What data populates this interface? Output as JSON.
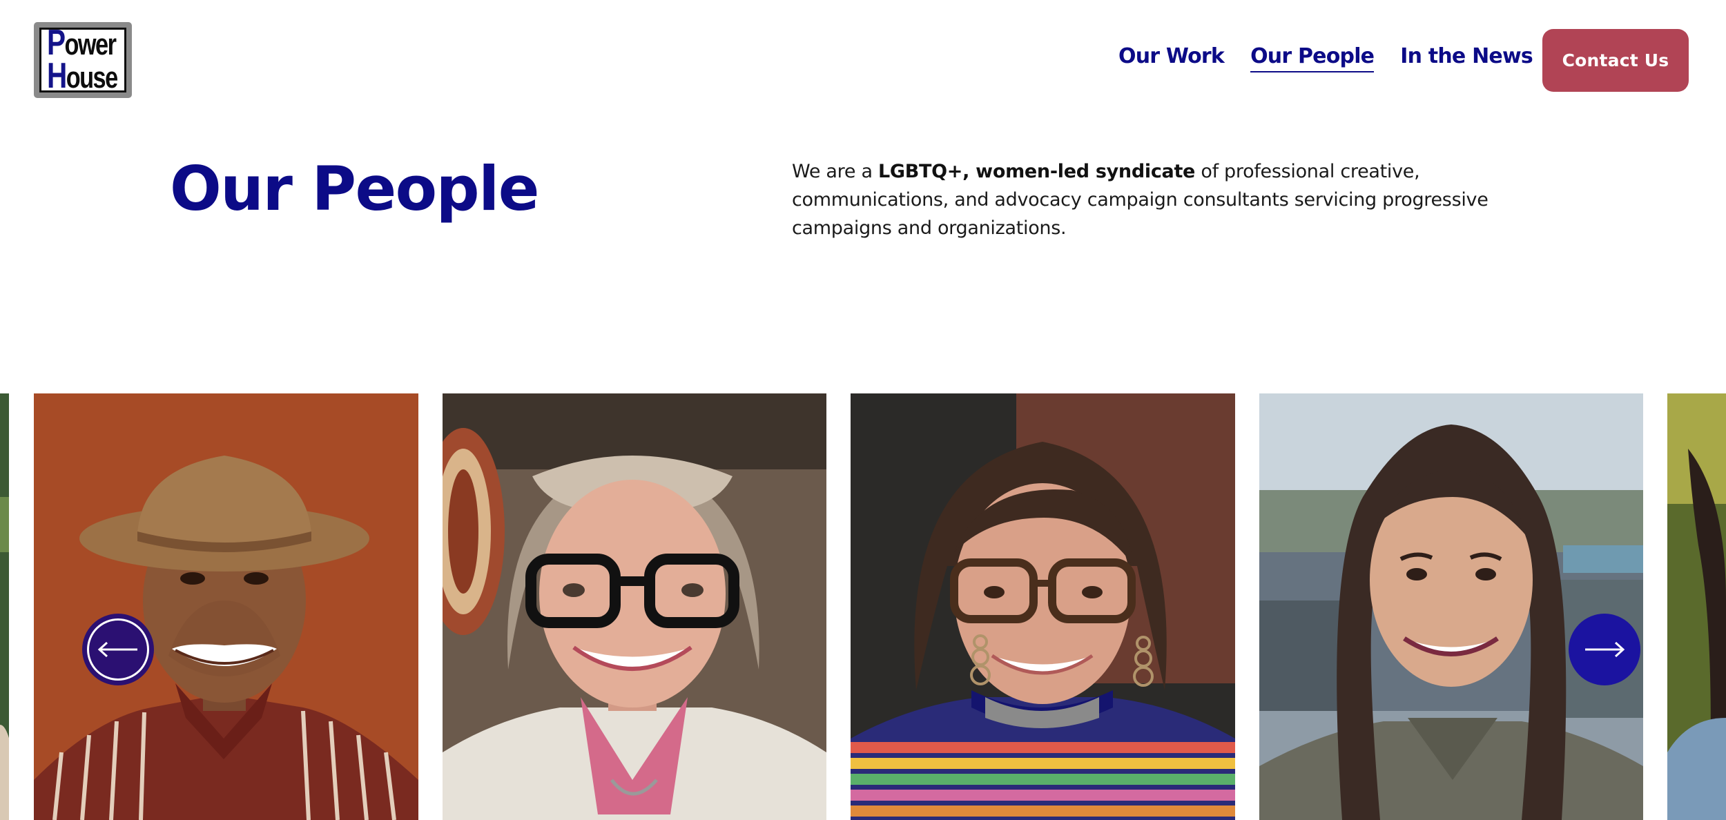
{
  "brand": {
    "logo_line1": "ower",
    "logo_line2": "ouse",
    "logo_cap1": "P",
    "logo_cap2": "H"
  },
  "nav": {
    "items": [
      {
        "label": "Our Work",
        "active": false
      },
      {
        "label": "Our People",
        "active": true
      },
      {
        "label": "In the News",
        "active": false
      }
    ],
    "contact_label": "Contact Us"
  },
  "hero": {
    "title": "Our People",
    "desc_before": "We are a ",
    "desc_bold": "LGBTQ+, women-led syndicate",
    "desc_after": " of professional creative, communications, and advocacy campaign consultants servicing progressive campaigns and organizations."
  },
  "carousel": {
    "prev_icon": "arrow-left-icon",
    "next_icon": "arrow-right-icon"
  },
  "colors": {
    "brand_blue": "#0c0b87",
    "contact_red": "#b14455",
    "arrow_dark": "#2b1072",
    "arrow_blue": "#1b13a0"
  }
}
